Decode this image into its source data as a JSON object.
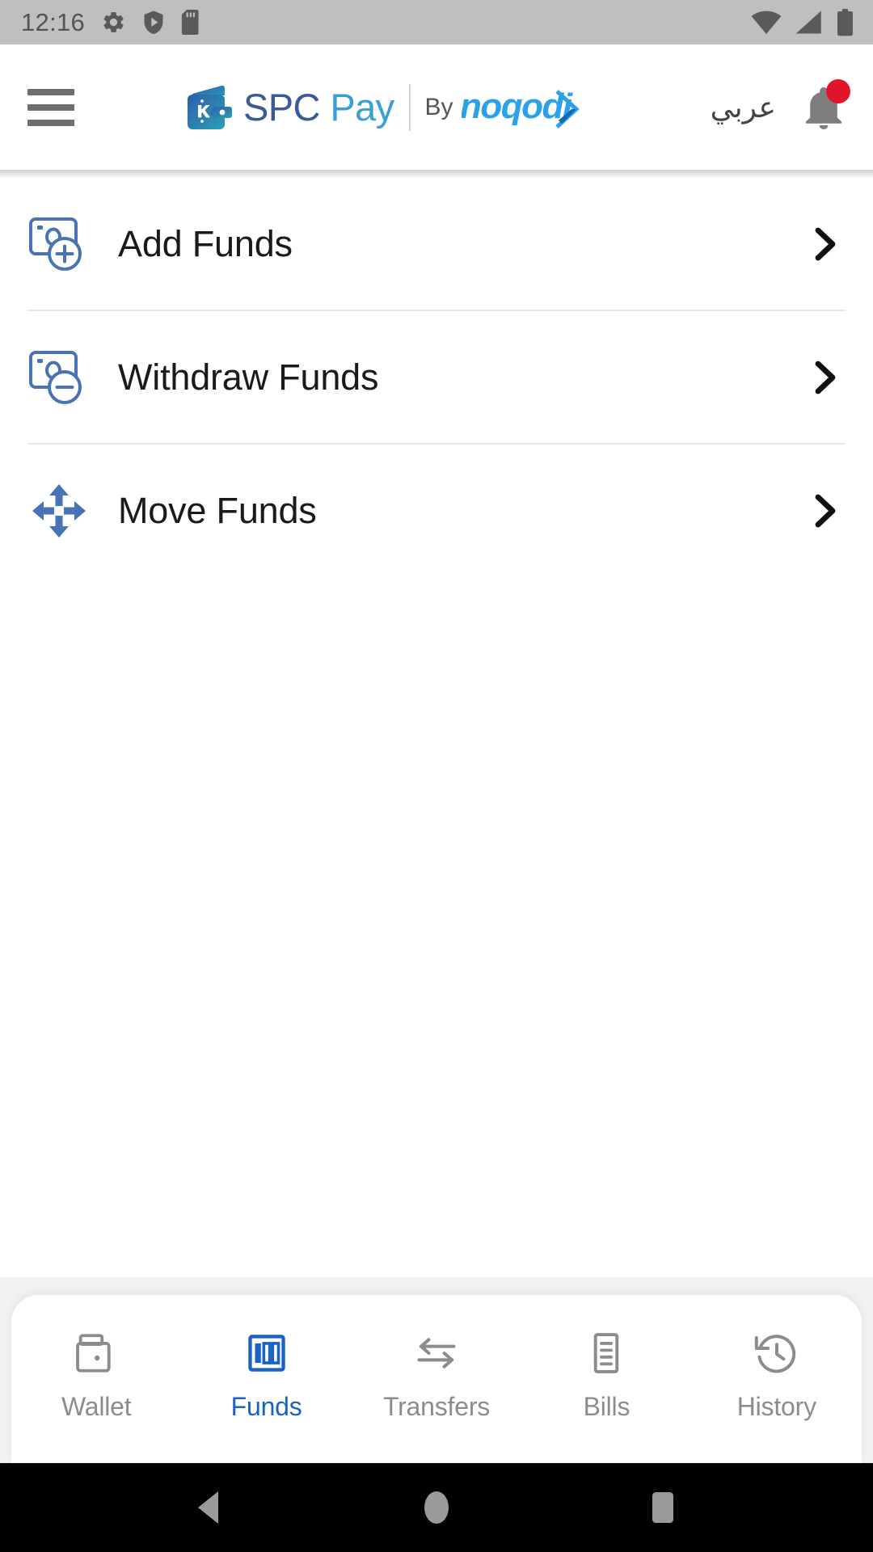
{
  "status_bar": {
    "time": "12:16",
    "left_icons": [
      "gear-icon",
      "shield-play-icon",
      "sd-card-icon"
    ],
    "right_icons": [
      "wifi-icon",
      "cell-signal-icon",
      "battery-icon"
    ],
    "background_color": "#bfbfbf",
    "icon_color": "#5a5a5a"
  },
  "header": {
    "menu_icon": "hamburger-menu-icon",
    "brand_spc": "SPC",
    "brand_pay": " Pay",
    "by_label": "By",
    "partner_brand": "noqodi",
    "language_toggle": "عربي",
    "notification_icon": "bell-icon",
    "notification_badge": true,
    "colors": {
      "spc": "#3a5a9a",
      "pay": "#3a9fd4",
      "noqodi": "#29a3e8",
      "badge": "#e0152b"
    }
  },
  "menu": {
    "items": [
      {
        "label": "Add Funds",
        "icon": "card-add-icon",
        "chevron": "chevron-right-icon"
      },
      {
        "label": "Withdraw Funds",
        "icon": "card-minus-icon",
        "chevron": "chevron-right-icon"
      },
      {
        "label": "Move Funds",
        "icon": "move-arrows-icon",
        "chevron": "chevron-right-icon"
      }
    ],
    "icon_color": "#4a73b5"
  },
  "bottom_nav": {
    "active_index": 1,
    "active_color": "#1a62c4",
    "inactive_color": "#8c8c8c",
    "tabs": [
      {
        "label": "Wallet",
        "icon": "wallet-icon"
      },
      {
        "label": "Funds",
        "icon": "banknote-icon"
      },
      {
        "label": "Transfers",
        "icon": "transfer-arrows-icon"
      },
      {
        "label": "Bills",
        "icon": "bill-document-icon"
      },
      {
        "label": "History",
        "icon": "clock-history-icon"
      }
    ]
  },
  "android_nav": {
    "buttons": [
      "back-button",
      "home-button",
      "recents-button"
    ],
    "color": "#9a9a9a",
    "background": "#000000"
  }
}
